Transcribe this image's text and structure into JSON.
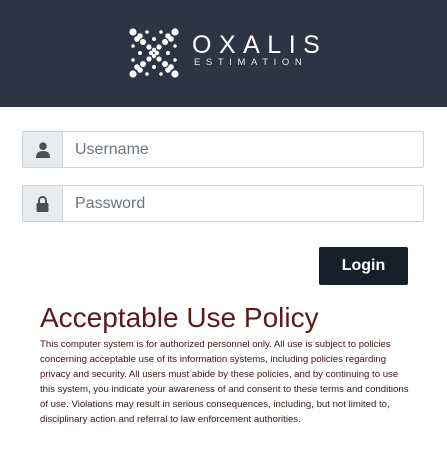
{
  "header": {
    "brand_name": "OXALIS",
    "brand_subtitle": "ESTIMATION",
    "background_color": "#2b3543",
    "logo_icon": "oxalis-x-dot-logo"
  },
  "login_form": {
    "username": {
      "placeholder": "Username",
      "value": "",
      "icon": "user-icon"
    },
    "password": {
      "placeholder": "Password",
      "value": "",
      "icon": "lock-icon"
    },
    "login_button_label": "Login",
    "button_color": "#15202b"
  },
  "policy": {
    "title": "Acceptable Use Policy",
    "body": "This computer system is for authorized personnel only. All use is subject to policies concerning acceptable use of its information systems, including policies regarding privacy and security. All users must abide by these policies, and by continuing to use this system, you indicate your awareness of and consent to these terms and conditions of use. Violations may result in serious consequences, including, but not limited to, disciplinary action and referral to law enforcement authorities.",
    "title_color": "#5b1a1c"
  }
}
